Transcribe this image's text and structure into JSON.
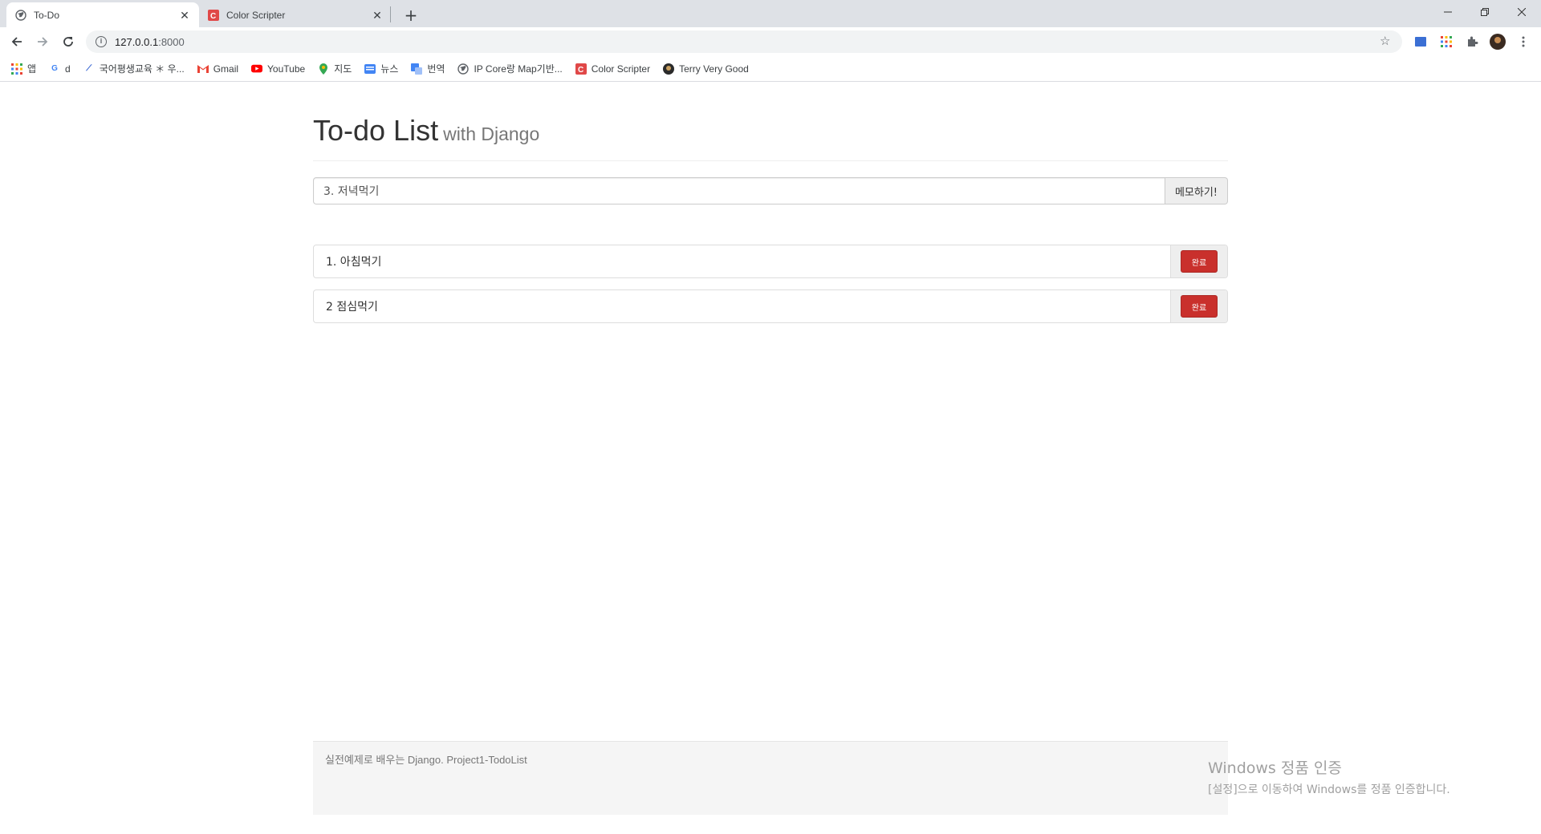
{
  "browser": {
    "tabs": [
      {
        "title": "To-Do",
        "active": true,
        "icon": "globe-icon"
      },
      {
        "title": "Color Scripter",
        "active": false,
        "icon": "color-scripter-icon"
      }
    ],
    "address": {
      "host": "127.0.0.1",
      "port": ":8000"
    },
    "bookmarks": [
      {
        "label": "앱",
        "icon": "apps-grid-icon"
      },
      {
        "label": "d",
        "icon": "google-icon"
      },
      {
        "label": "국어평생교육 ＊ 우...",
        "icon": "arrow-logo-icon"
      },
      {
        "label": "Gmail",
        "icon": "gmail-icon"
      },
      {
        "label": "YouTube",
        "icon": "youtube-icon"
      },
      {
        "label": "지도",
        "icon": "maps-pin-icon"
      },
      {
        "label": "뉴스",
        "icon": "news-icon"
      },
      {
        "label": "번역",
        "icon": "translate-icon"
      },
      {
        "label": "IP Core랑 Map기반...",
        "icon": "globe-icon"
      },
      {
        "label": "Color Scripter",
        "icon": "color-scripter-icon"
      },
      {
        "label": "Terry Very Good",
        "icon": "terry-avatar-icon"
      }
    ]
  },
  "header": {
    "title": "To-do List",
    "subtitle": "with Django"
  },
  "memo_form": {
    "input_value": "3. 저녁먹기",
    "button_label": "메모하기!"
  },
  "todos": [
    {
      "text": "1. 아침먹기",
      "button_label": "완료"
    },
    {
      "text": "2 점심먹기",
      "button_label": "완료"
    }
  ],
  "footer": {
    "text": "실전예제로 배우는 Django. Project1-TodoList"
  },
  "watermark": {
    "line1": "Windows 정품 인증",
    "line2": "[설정]으로 이동하여 Windows를 정품 인증합니다."
  },
  "colors": {
    "danger": "#c9302c",
    "chrome_bg": "#dee1e6"
  }
}
